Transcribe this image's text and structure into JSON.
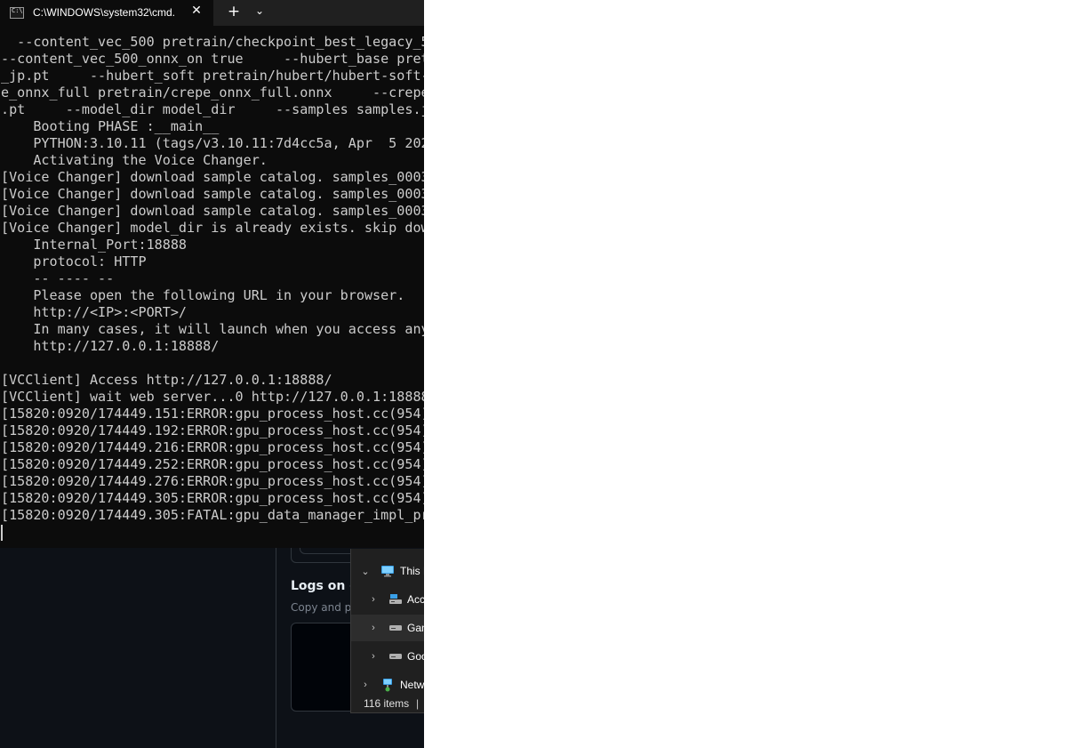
{
  "terminal": {
    "tab_title": "C:\\WINDOWS\\system32\\cmd.",
    "tab_icon_text": "C:\\",
    "close_glyph": "✕",
    "new_tab_glyph": "+",
    "dropdown_glyph": "⌄",
    "lines": [
      "  --content_vec_500 pretrain/checkpoint_best_legacy_5",
      "--content_vec_500_onnx_on true     --hubert_base pret",
      "_jp.pt     --hubert_soft pretrain/hubert/hubert-soft-",
      "e_onnx_full pretrain/crepe_onnx_full.onnx     --crepe",
      ".pt     --model_dir model_dir     --samples samples.j",
      "    Booting PHASE :__main__",
      "    PYTHON:3.10.11 (tags/v3.10.11:7d4cc5a, Apr  5 202",
      "    Activating the Voice Changer.",
      "[Voice Changer] download sample catalog. samples_0003",
      "[Voice Changer] download sample catalog. samples_0003",
      "[Voice Changer] download sample catalog. samples_0003",
      "[Voice Changer] model_dir is already exists. skip dow",
      "    Internal_Port:18888",
      "    protocol: HTTP",
      "    -- ---- --",
      "    Please open the following URL in your browser.",
      "    http://<IP>:<PORT>/",
      "    In many cases, it will launch when you access any",
      "    http://127.0.0.1:18888/",
      "",
      "[VCClient] Access http://127.0.0.1:18888/",
      "[VCClient] wait web server...0 http://127.0.0.1:18888",
      "[15820:0920/174449.151:ERROR:gpu_process_host.cc(954)",
      "[15820:0920/174449.192:ERROR:gpu_process_host.cc(954)",
      "[15820:0920/174449.216:ERROR:gpu_process_host.cc(954)",
      "[15820:0920/174449.252:ERROR:gpu_process_host.cc(954)",
      "[15820:0920/174449.276:ERROR:gpu_process_host.cc(954)",
      "[15820:0920/174449.305:ERROR:gpu_process_host.cc(954)",
      "[15820:0920/174449.305:FATAL:gpu_data_manager_impl_pr"
    ]
  },
  "background_page": {
    "logs_heading": "Logs on co",
    "logs_subtitle": "Copy and pa"
  },
  "explorer": {
    "items": [
      {
        "label": "This P",
        "icon": "this-pc-icon",
        "chevron": "⌄"
      },
      {
        "label": "Acc",
        "icon": "accessory-drive-icon",
        "chevron": "›"
      },
      {
        "label": "Gan",
        "icon": "drive-icon",
        "chevron": "›"
      },
      {
        "label": "Goo",
        "icon": "drive-icon",
        "chevron": "›"
      },
      {
        "label": "Netw",
        "icon": "network-icon",
        "chevron": "›"
      }
    ],
    "status_text": "116 items",
    "status_separator": "|"
  },
  "colors": {
    "terminal_bg": "#0c0c0c",
    "terminal_fg": "#cccccc",
    "titlebar_bg": "#202020",
    "explorer_bg": "#202020",
    "page_bg": "#0d1117"
  }
}
